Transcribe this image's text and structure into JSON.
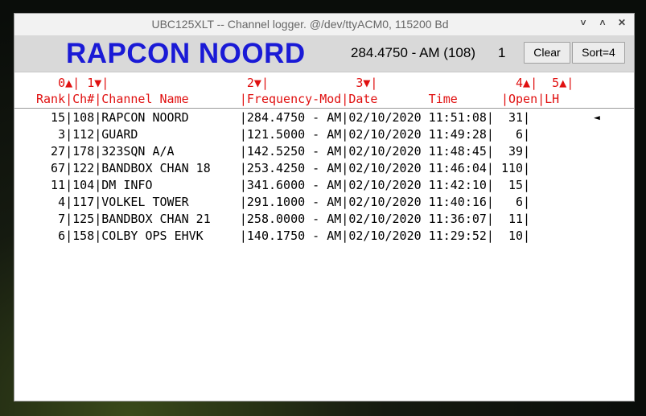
{
  "window": {
    "title": "UBC125XLT -- Channel logger.  @/dev/ttyACM0, 115200 Bd",
    "controls": [
      "˅",
      "˄",
      "✕"
    ]
  },
  "header": {
    "station": "RAPCON NOORD",
    "frequency": "284.4750 - AM (108)",
    "count": "1",
    "clear_label": "Clear",
    "sort_label": "Sort=4"
  },
  "columns": {
    "sort_line": "   0▲| 1▼|                   2▼|            3▼|                   4▲|  5▲|",
    "header_line": "Rank|Ch#|Channel Name       |Frequency-Mod|Date       Time      |Open|LH"
  },
  "rows": [
    "  15|108|RAPCON NOORD       |284.4750 - AM|02/10/2020 11:51:08|  31|",
    "   3|112|GUARD              |121.5000 - AM|02/10/2020 11:49:28|   6|",
    "  27|178|323SQN A/A         |142.5250 - AM|02/10/2020 11:48:45|  39|",
    "  67|122|BANDBOX CHAN 18    |253.4250 - AM|02/10/2020 11:46:04| 110|",
    "  11|104|DM INFO            |341.6000 - AM|02/10/2020 11:42:10|  15|",
    "   4|117|VOLKEL TOWER       |291.1000 - AM|02/10/2020 11:40:16|   6|",
    "   7|125|BANDBOX CHAN 21    |258.0000 - AM|02/10/2020 11:36:07|  11|",
    "   6|158|COLBY OPS EHVK     |140.1750 - AM|02/10/2020 11:29:52|  10|"
  ],
  "last_heard_marker": "◄",
  "colors": {
    "station": "#1a1ad6",
    "column_header": "#e01010",
    "header_bg": "#d9d9d9"
  }
}
